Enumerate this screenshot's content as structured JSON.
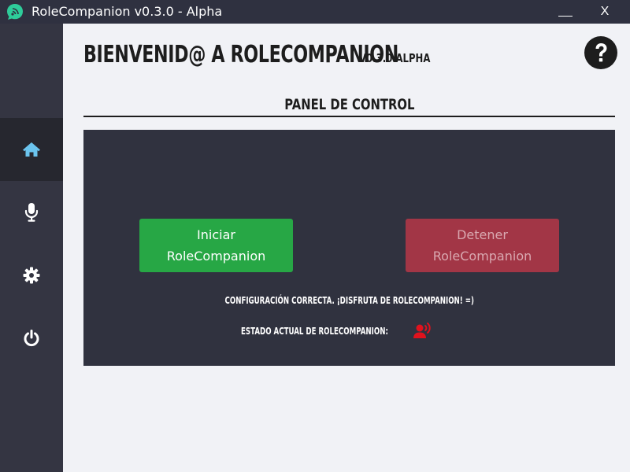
{
  "window": {
    "title": "RoleCompanion v0.3.0 - Alpha",
    "minimize_label": "",
    "close_label": "X"
  },
  "sidebar": {
    "items": [
      {
        "icon": "home-icon",
        "active": true
      },
      {
        "icon": "microphone-icon",
        "active": false
      },
      {
        "icon": "gear-icon",
        "active": false
      },
      {
        "icon": "power-icon",
        "active": false
      }
    ]
  },
  "header": {
    "title": "BIENVENID@ A ROLECOMPANION",
    "version": "V0.3.0 ALPHA"
  },
  "help": {
    "icon": "help-icon"
  },
  "control_panel": {
    "title": "PANEL DE CONTROL",
    "start_button": "Iniciar RoleCompanion",
    "stop_button": "Detener RoleCompanion",
    "config_message": "CONFIGURACIÓN CORRECTA. ¡DISFRUTA DE ROLECOMPANION! =)",
    "state_label": "ESTADO ACTUAL DE ROLECOMPANION:",
    "state_icon": "speaking-user-icon"
  },
  "colors": {
    "titlebar": "#2f3140",
    "sidebar": "#343542",
    "sidebar_active": "#26272f",
    "accent_icon": "#6bc4ee",
    "panel": "#30323f",
    "start": "#27a745",
    "stop": "#a23646",
    "state_icon": "#e0121d",
    "app_icon": "#2ecc9a"
  }
}
